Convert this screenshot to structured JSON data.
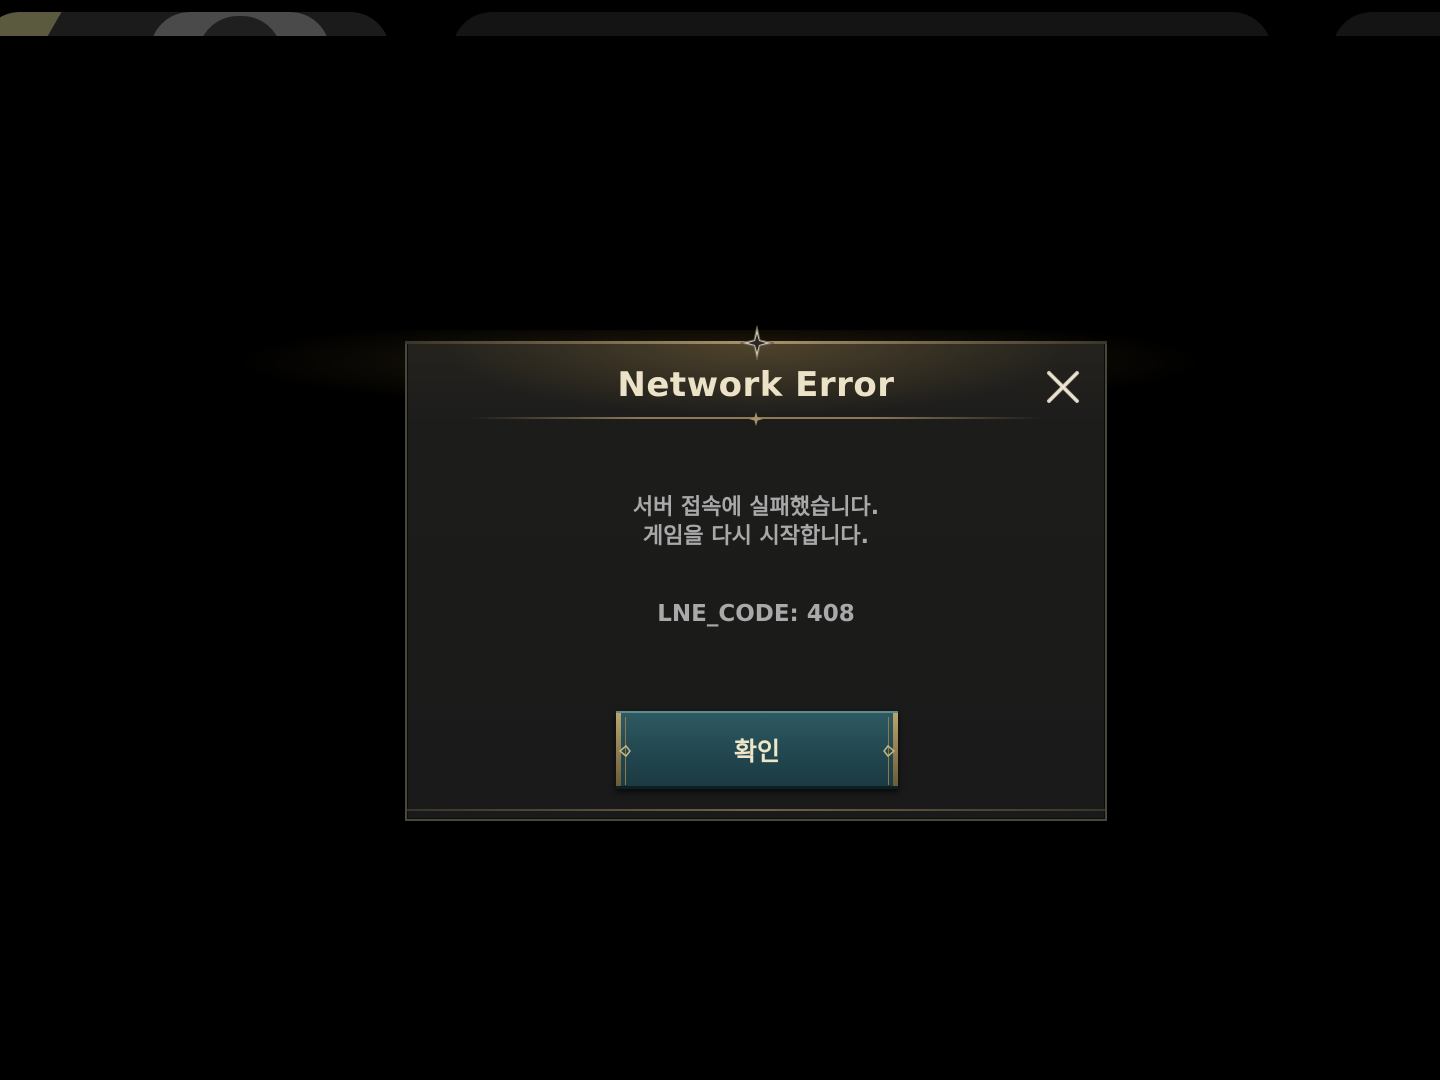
{
  "dialog": {
    "title": "Network Error",
    "message_line1": "서버 접속에 실패했습니다.",
    "message_line2": "게임을 다시 시작합니다.",
    "code": "LNE_CODE: 408",
    "confirm_label": "확인",
    "close_icon": "close-icon"
  },
  "colors": {
    "background": "#000000",
    "panel": "#1a1a1a",
    "title": "#ece2c8",
    "body_text": "#a9a9a9",
    "button": "#224750",
    "gold_trim": "#b9a56e"
  }
}
